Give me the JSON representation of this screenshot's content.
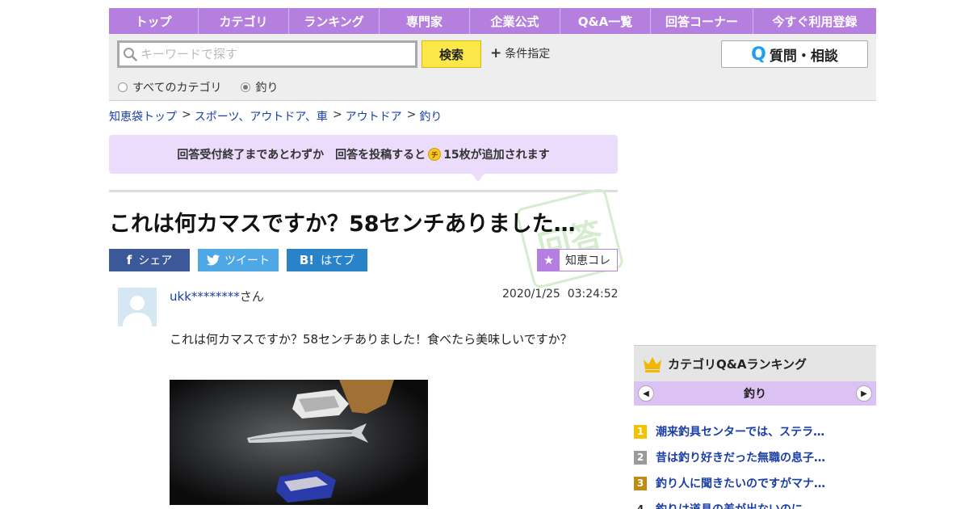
{
  "nav": {
    "items": [
      "トップ",
      "カテゴリ",
      "ランキング",
      "専門家",
      "企業公式",
      "Q&A一覧",
      "回答コーナー",
      "今すぐ利用登録"
    ]
  },
  "search": {
    "placeholder": "キーワードで探す",
    "button_label": "検索",
    "conditions_label": "条件指定",
    "ask_label": "質問・相談",
    "scope_all": "すべてのカテゴリ",
    "scope_current": "釣り"
  },
  "breadcrumb": [
    "知恵袋トップ",
    "スポーツ、アウトドア、車",
    "アウトドア",
    "釣り"
  ],
  "notice": {
    "text_before": "回答受付終了まであとわずか　回答を投稿すると",
    "coin_label": "チ",
    "text_after": "15枚が追加されます"
  },
  "question": {
    "title": "これは何カマスですか？58センチありました…",
    "stamp_text": "回答",
    "share": {
      "facebook": "シェア",
      "twitter": "ツイート",
      "hatena": "はてブ",
      "hatena_icon": "B!"
    },
    "chiekore_label": "知恵コレ",
    "user_name": "ukk********",
    "user_suffix": "さん",
    "date": "2020/1/25",
    "time": "03:24:52",
    "body": "これは何カマスですか？58センチありました！食べたら美味しいですか？"
  },
  "ranking": {
    "title": "カテゴリQ&Aランキング",
    "category": "釣り",
    "items": [
      {
        "rank": "1",
        "text": "潮来釣具センターでは、ステラ…",
        "color": "#f5c200"
      },
      {
        "rank": "2",
        "text": "昔は釣り好きだった無職の息子…",
        "color": "#9a9a9a"
      },
      {
        "rank": "3",
        "text": "釣り人に聞きたいのですがマナ…",
        "color": "#c28a10"
      },
      {
        "rank": "4",
        "text": "釣りは道具の差が出ないのに、…",
        "color": "#ffffff"
      }
    ]
  },
  "colors": {
    "nav_bg": "#b57fe0",
    "notice_bg": "#ebdcfb",
    "search_button": "#fde84a",
    "link": "#1a3ea8"
  }
}
